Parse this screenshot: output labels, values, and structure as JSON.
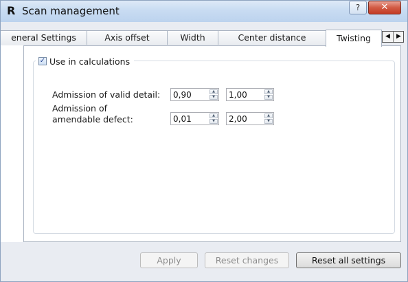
{
  "window": {
    "app_icon": "R",
    "title": "Scan management",
    "help_label": "?",
    "close_label": "✕"
  },
  "tabs": [
    {
      "label": "eneral Settings",
      "active": false
    },
    {
      "label": "Axis offset",
      "active": false
    },
    {
      "label": "Width",
      "active": false
    },
    {
      "label": "Center distance",
      "active": false
    },
    {
      "label": "Twisting",
      "active": true
    }
  ],
  "tab_scroll": {
    "left_icon": "◀",
    "right_icon": "▶"
  },
  "group": {
    "checkbox_checked": true,
    "check_mark": "✓",
    "label": "Use in calculations"
  },
  "rows": [
    {
      "label_line1": "Admission of valid detail:",
      "label_line2": "",
      "value1": "0,90",
      "value2": "1,00"
    },
    {
      "label_line1": "Admission of",
      "label_line2": "amendable defect:",
      "value1": "0,01",
      "value2": "2,00"
    }
  ],
  "spin_icons": {
    "up": "▲",
    "down": "▼"
  },
  "buttons": {
    "apply": "Apply",
    "reset_changes": "Reset changes",
    "reset_all": "Reset all settings"
  }
}
